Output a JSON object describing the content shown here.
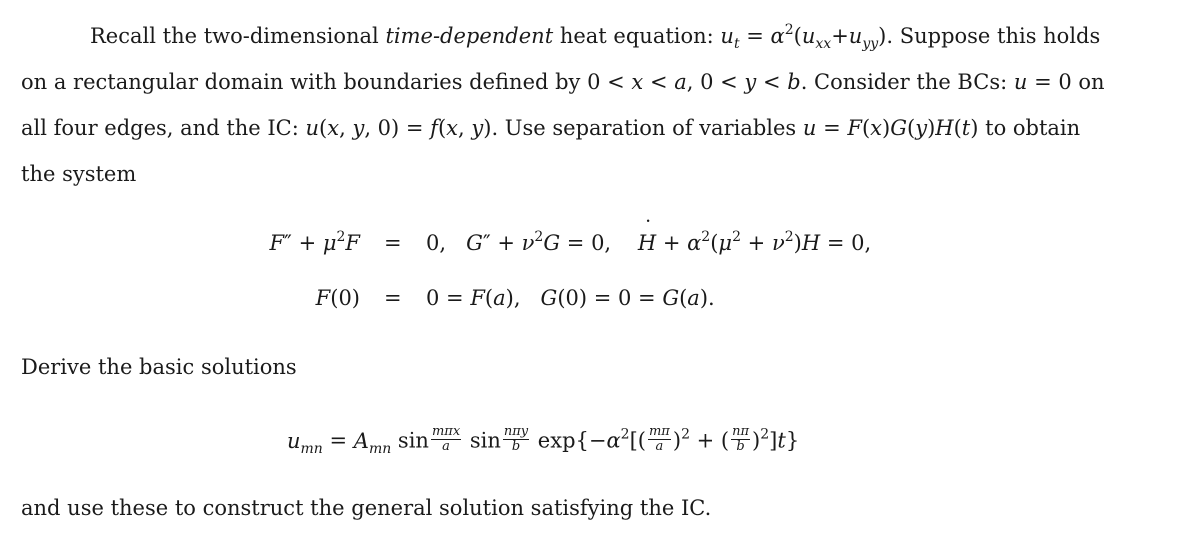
{
  "paragraph1": {
    "line1_a": "Recall the two-dimensional ",
    "line1_italic": "time-dependent",
    "line1_b": " heat equation: ",
    "line1_c": ". Suppose this holds",
    "line2_a": "on a rectangular domain with boundaries defined by ",
    "line2_b": ". Consider the BCs: ",
    "line2_c": " on",
    "line3_a": "all four edges, and the IC: ",
    "line3_b": ". Use separation of variables ",
    "line3_c": " to obtain",
    "line4": "the system"
  },
  "math": {
    "heat_eq": "uₜ = α²(uₓₓ + u_yy)",
    "domain": "0 < x < a, 0 < y < b",
    "bc": "u = 0",
    "ic": "u(x, y, 0) = f(x, y)",
    "separation": "u = F(x)G(y)H(t)",
    "system_row1_lhs": "F″ + μ²F",
    "system_row1_rhs": "0,  G″ + ν²G = 0,  Ḣ + α²(μ² + ν²)H = 0,",
    "system_row2_lhs": "F(0)",
    "system_row2_rhs": "0 = F(a),  G(0) = 0 = G(a).",
    "equals": "=",
    "basic_solution": "u_mn = A_mn sin(mπx/a) sin(nπy/b) exp{−α²[(mπ/a)² + (nπ/b)²]t}"
  },
  "paragraph2": "Derive the basic solutions",
  "paragraph3": "and use these to construct the general solution satisfying the IC."
}
